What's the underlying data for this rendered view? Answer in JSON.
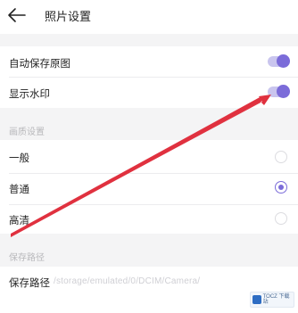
{
  "header": {
    "title": "照片设置",
    "back_icon": "arrow-left-icon"
  },
  "settings": {
    "auto_save_original": {
      "label": "自动保存原图",
      "enabled": true
    },
    "show_watermark": {
      "label": "显示水印",
      "enabled": true
    }
  },
  "quality": {
    "section_title": "画质设置",
    "options": [
      {
        "label": "一般",
        "selected": false
      },
      {
        "label": "普通",
        "selected": true
      },
      {
        "label": "高清",
        "selected": false
      }
    ]
  },
  "save_path": {
    "section_title": "保存路径",
    "label": "保存路径",
    "value": "/storage/emulated/0/DCIM/Camera/"
  },
  "watermark_badge": {
    "text": "TOCZ 下载站"
  },
  "colors": {
    "accent": "#7b6cd9",
    "annotation_arrow": "#e0313f"
  }
}
